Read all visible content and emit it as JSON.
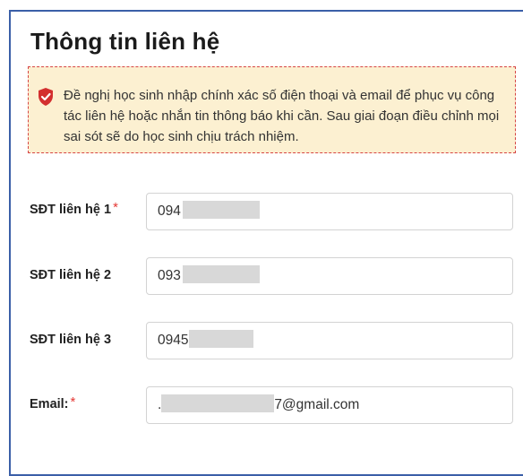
{
  "section": {
    "title": "Thông tin liên hệ"
  },
  "notice": {
    "icon": "shield-check-icon",
    "text": "Đề nghị học sinh nhập chính xác số điện thoại và email để phục vụ công tác liên hệ hoặc nhắn tin thông báo khi cần. Sau giai đoạn điều chỉnh mọi sai sót sẽ do học sinh chịu trách nhiệm."
  },
  "fields": {
    "phone1": {
      "label": "SĐT liên hệ 1",
      "required_mark": "*",
      "value_visible": "094"
    },
    "phone2": {
      "label": "SĐT liên hệ 2",
      "value_visible": "093"
    },
    "phone3": {
      "label": "SĐT liên hệ 3",
      "value_visible": "0945"
    },
    "email": {
      "label": "Email:",
      "required_mark": "*",
      "value_prefix": ".",
      "value_suffix": "7@gmail.com"
    }
  },
  "colors": {
    "card_border": "#3b5fa8",
    "notice_bg": "#fcf0d1",
    "notice_border": "#d64545",
    "required": "#e53935",
    "shield": "#d32f2f"
  }
}
